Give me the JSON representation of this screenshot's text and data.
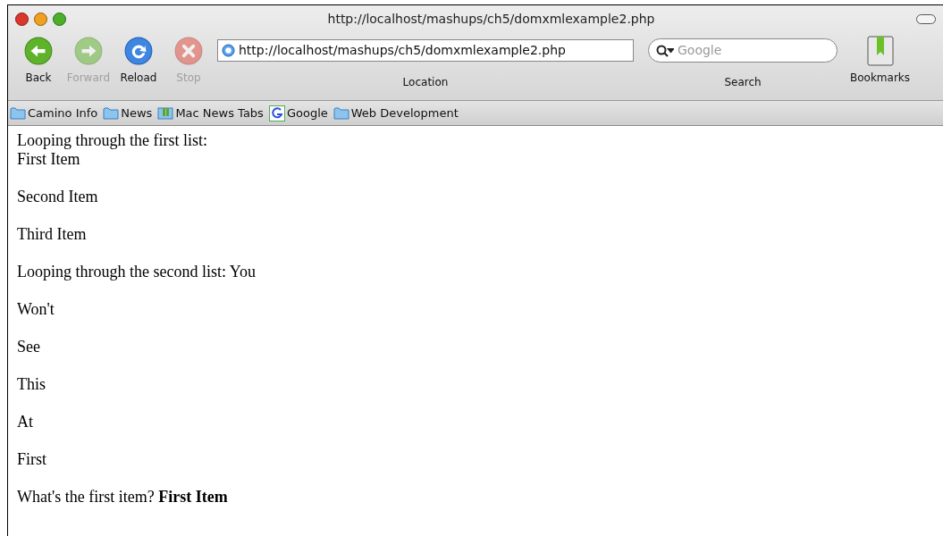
{
  "window": {
    "title": "http://localhost/mashups/ch5/domxmlexample2.php"
  },
  "toolbar": {
    "buttons": [
      {
        "kind": "back",
        "label": "Back",
        "disabled": false
      },
      {
        "kind": "forward",
        "label": "Forward",
        "disabled": true
      },
      {
        "kind": "reload",
        "label": "Reload",
        "disabled": false
      },
      {
        "kind": "stop",
        "label": "Stop",
        "disabled": true
      }
    ],
    "location": {
      "value": "http://localhost/mashups/ch5/domxmlexample2.php",
      "label": "Location"
    },
    "search": {
      "placeholder": "Google",
      "label": "Search"
    },
    "bookmarks_button": {
      "label": "Bookmarks"
    }
  },
  "bookmarks_bar": [
    {
      "kind": "folder",
      "label": "Camino Info"
    },
    {
      "kind": "folder",
      "label": "News"
    },
    {
      "kind": "tabs",
      "label": "Mac News Tabs"
    },
    {
      "kind": "google",
      "label": "Google"
    },
    {
      "kind": "folder",
      "label": "Web Development"
    }
  ],
  "content": {
    "first_block": [
      "Looping through the first list:",
      "First Item"
    ],
    "paragraphs": [
      "Second Item",
      "Third Item",
      "Looping through the second list: You",
      "Won't",
      "See",
      "This",
      "At",
      "First",
      "What's the first item? **First Item**"
    ]
  }
}
